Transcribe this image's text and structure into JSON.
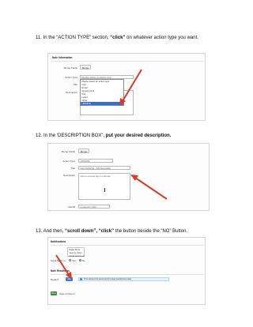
{
  "steps": [
    {
      "number": "11.",
      "pre": " In the “ACTION TYPE” section, ",
      "bold": "“click”",
      "post": " on whatever action type you want."
    },
    {
      "number": "12.",
      "pre": " In the ‘DESCRIPTION BOX”, ",
      "bold": "put your desired description.",
      "post": ""
    },
    {
      "number": "13.",
      "pre": " And then, ",
      "bold": "“scroll down”, “click”",
      "post": " the button beside the “NO” Button."
    }
  ],
  "shot1": {
    "section_title": "Note Information",
    "merge_fields_label": "Merge Fields",
    "merge_button": "Merge",
    "action_type_label": "Action Type",
    "action_type_value": "Please select an action type",
    "title_label": "Title",
    "description_label": "Description",
    "options": [
      "Please select an action type",
      "Call",
      "Email",
      "Appointment",
      "Fax",
      "Letter",
      "Other",
      "UPDATE"
    ],
    "selected_index": 7
  },
  "shot2": {
    "merge_fields_label": "Merge Fields",
    "merge_button": "Merge",
    "action_type_label": "Action Type",
    "action_type_value": "UPDATE",
    "title_label": "Title",
    "title_value": "New Referral - Add Everyday",
    "description_label": "Description",
    "description_value": "Add a received day to referrals",
    "user_label": "UserID",
    "user_value": "Logged In User"
  },
  "shot3": {
    "notifications_title": "Notifications",
    "notify_names": [
      "Katie Sims",
      "Jeremy Sims",
      "Nona Jamieson"
    ],
    "send_notify_label": "Send Notify to",
    "yes_label": "Yes",
    "no_label": "No",
    "note_readiness_title": "Note Readiness",
    "ready_label": "Ready?",
    "toggle_label": "No",
    "info_text": "This causes the users and if a logo needed as ready",
    "save_button": "Save",
    "save_return_label": "Save & Return"
  },
  "colors": {
    "arrow": "#d93a2b",
    "selected": "#2f6fd6",
    "save": "#3b8b3b"
  }
}
